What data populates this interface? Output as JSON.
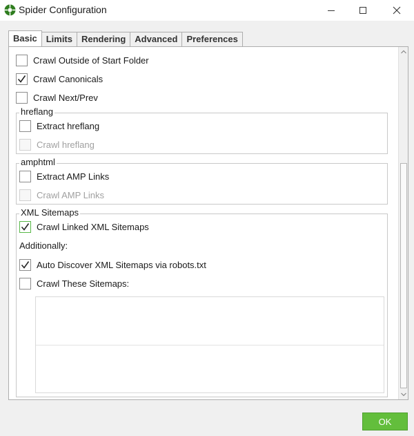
{
  "window": {
    "title": "Spider Configuration",
    "icon": "spider-icon"
  },
  "tabs": [
    {
      "label": "Basic",
      "active": true
    },
    {
      "label": "Limits",
      "active": false
    },
    {
      "label": "Rendering",
      "active": false
    },
    {
      "label": "Advanced",
      "active": false
    },
    {
      "label": "Preferences",
      "active": false
    }
  ],
  "options": {
    "crawl_outside": {
      "label": "Crawl Outside of Start Folder",
      "checked": false
    },
    "crawl_canonicals": {
      "label": "Crawl Canonicals",
      "checked": true
    },
    "crawl_next_prev": {
      "label": "Crawl Next/Prev",
      "checked": false
    }
  },
  "hreflang": {
    "legend": "hreflang",
    "extract": {
      "label": "Extract hreflang",
      "checked": false
    },
    "crawl": {
      "label": "Crawl hreflang",
      "checked": false,
      "disabled": true
    }
  },
  "amphtml": {
    "legend": "amphtml",
    "extract": {
      "label": "Extract AMP Links",
      "checked": false
    },
    "crawl": {
      "label": "Crawl AMP Links",
      "checked": false,
      "disabled": true
    }
  },
  "xml_sitemaps": {
    "legend": "XML Sitemaps",
    "crawl_linked": {
      "label": "Crawl Linked XML Sitemaps",
      "checked": true
    },
    "additionally": "Additionally:",
    "auto_discover": {
      "label": "Auto Discover XML Sitemaps via robots.txt",
      "checked": true
    },
    "crawl_these": {
      "label": "Crawl These Sitemaps:",
      "checked": false
    },
    "sitemaps_text": ""
  },
  "footer": {
    "ok_label": "OK"
  },
  "colors": {
    "accent": "#63be3c",
    "focus_border": "#57b847"
  }
}
